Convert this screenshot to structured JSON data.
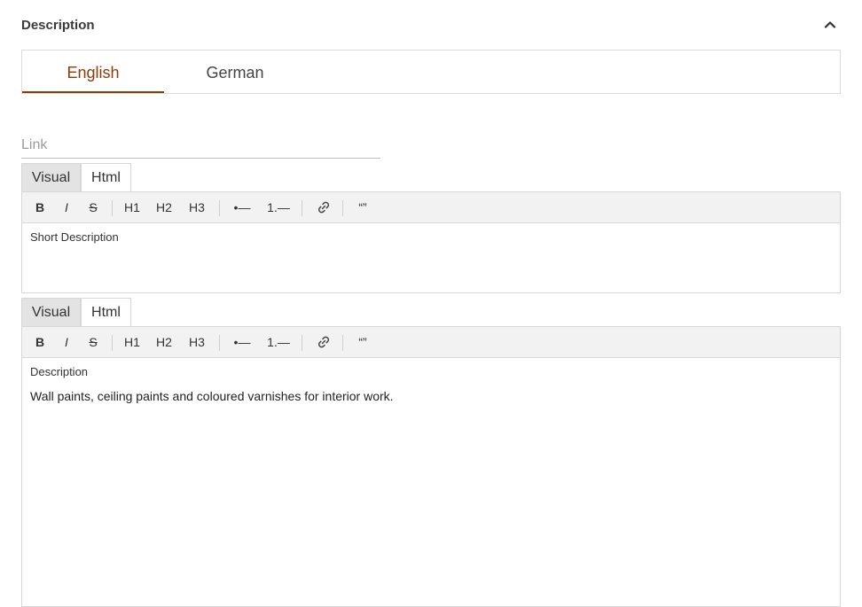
{
  "section": {
    "title": "Description"
  },
  "language_tabs": [
    {
      "label": "English",
      "active": true
    },
    {
      "label": "German",
      "active": false
    }
  ],
  "link": {
    "placeholder": "Link",
    "value": ""
  },
  "toolbar": {
    "bold": "B",
    "italic": "I",
    "strike": "S",
    "h1": "H1",
    "h2": "H2",
    "h3": "H3",
    "bullet_list": "•—",
    "ordered_list": "1.—",
    "link_icon": "link-icon",
    "quote": "“”"
  },
  "editors": [
    {
      "mode_tabs": [
        "Visual",
        "Html"
      ],
      "active_mode": "Visual",
      "label": "Short Description",
      "content": ""
    },
    {
      "mode_tabs": [
        "Visual",
        "Html"
      ],
      "active_mode": "Visual",
      "label": "Description",
      "content": "Wall paints, ceiling paints and coloured varnishes for interior work."
    }
  ],
  "colors": {
    "accent": "#8a3b0a",
    "toolbar_bg": "#f2f2f2",
    "active_mode_bg": "#e3e3e3"
  }
}
